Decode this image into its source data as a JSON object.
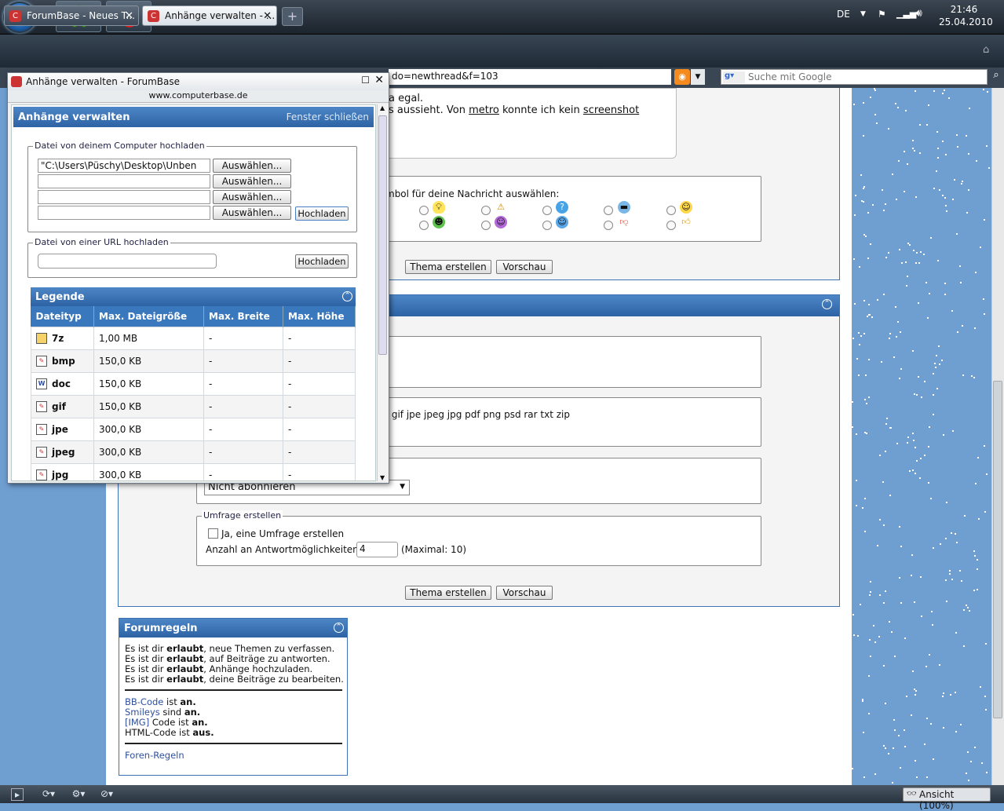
{
  "taskbar": {
    "language": "DE",
    "time": "21:46",
    "date": "25.04.2010",
    "pinned": [
      "windows-start",
      "icq",
      "opera"
    ]
  },
  "browser": {
    "tabs": [
      {
        "label": "ForumBase - Neues T...",
        "active": false
      },
      {
        "label": "Anhänge verwalten - ...",
        "active": true
      }
    ],
    "address_fragment": "do=newthread&f=103",
    "search_placeholder": "Suche mit Google",
    "zoom_label": "Ansicht (100%)"
  },
  "page": {
    "post_text_line1": "a egal.",
    "post_text_line2_prefix": "s aussieht. Von ",
    "post_text_link1": "metro",
    "post_text_line2_mid": " konnte ich kein ",
    "post_text_link2": "screenshot",
    "symbol_label": "mbol für deine Nachricht auswählen:",
    "btn_create_thread": "Thema erstellen",
    "btn_preview": "Vorschau",
    "allowed_types_fragment": ": gif jpe jpeg jpg pdf png psd rar txt zip",
    "subscribe_value": "Nicht abonnieren",
    "poll": {
      "legend": "Umfrage erstellen",
      "checkbox_label": "Ja, eine Umfrage erstellen",
      "options_label": "Anzahl an Antwortmöglichkeiten:",
      "options_value": "4",
      "options_max": "(Maximal: 10)"
    },
    "rules": {
      "title": "Forumregeln",
      "lines": [
        {
          "pre": "Es ist dir ",
          "bold": "erlaubt",
          "post": ", neue Themen zu verfassen."
        },
        {
          "pre": "Es ist dir ",
          "bold": "erlaubt",
          "post": ", auf Beiträge zu antworten."
        },
        {
          "pre": "Es ist dir ",
          "bold": "erlaubt",
          "post": ", Anhänge hochzuladen."
        },
        {
          "pre": "Es ist dir ",
          "bold": "erlaubt",
          "post": ", deine Beiträge zu bearbeiten."
        }
      ],
      "bbcode_link": "BB-Code",
      "bbcode_mid": " ist ",
      "bbcode_state": "an.",
      "smileys_link": "Smileys",
      "smileys_mid": " sind ",
      "smileys_state": "an.",
      "img_link": "[IMG]",
      "img_mid": " Code ist ",
      "img_state": "an.",
      "html_pre": "HTML-Code ist ",
      "html_state": "aus.",
      "forum_rules_link": "Foren-Regeln"
    }
  },
  "popup": {
    "window_title": "Anhänge verwalten - ForumBase",
    "url": "www.computerbase.de",
    "header_title": "Anhänge verwalten",
    "close_link": "Fenster schließen",
    "upload_computer_legend": "Datei von deinem Computer hochladen",
    "file_inputs": [
      "\"C:\\Users\\Püschy\\Desktop\\Unben",
      "",
      "",
      ""
    ],
    "browse_label": "Auswählen...",
    "upload_label": "Hochladen",
    "upload_url_legend": "Datei von einer URL hochladen",
    "url_input_value": "",
    "legend_title": "Legende",
    "legend_columns": [
      "Dateityp",
      "Max. Dateigröße",
      "Max. Breite",
      "Max. Höhe"
    ],
    "legend_rows": [
      {
        "type": "7z",
        "size": "1,00 MB",
        "width": "-",
        "height": "-",
        "icon": "archive-icon"
      },
      {
        "type": "bmp",
        "size": "150,0 KB",
        "width": "-",
        "height": "-",
        "icon": "image-file-icon"
      },
      {
        "type": "doc",
        "size": "150,0 KB",
        "width": "-",
        "height": "-",
        "icon": "word-doc-icon"
      },
      {
        "type": "gif",
        "size": "150,0 KB",
        "width": "-",
        "height": "-",
        "icon": "image-file-icon"
      },
      {
        "type": "jpe",
        "size": "300,0 KB",
        "width": "-",
        "height": "-",
        "icon": "image-file-icon"
      },
      {
        "type": "jpeg",
        "size": "300,0 KB",
        "width": "-",
        "height": "-",
        "icon": "image-file-icon"
      },
      {
        "type": "jpg",
        "size": "300,0 KB",
        "width": "-",
        "height": "-",
        "icon": "image-file-icon"
      }
    ]
  },
  "colors": {
    "accent": "#3a78bd",
    "page_bg": "#6f9ed0",
    "link": "#2f4f9e"
  }
}
